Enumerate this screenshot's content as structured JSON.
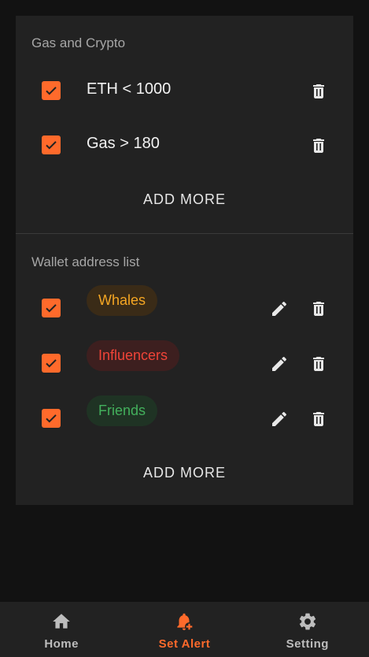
{
  "colors": {
    "accent": "#ff6a2b",
    "background": "#121212",
    "card": "#222222",
    "whales": "#f5a623",
    "influencers": "#f04438",
    "friends": "#43b05c"
  },
  "gas_section": {
    "title": "Gas and Crypto",
    "items": [
      {
        "label": "ETH < 1000",
        "checked": true
      },
      {
        "label": "Gas > 180",
        "checked": true
      }
    ],
    "add_more": "ADD MORE"
  },
  "wallet_section": {
    "title": "Wallet address list",
    "items": [
      {
        "label": "Whales",
        "checked": true
      },
      {
        "label": "Influencers",
        "checked": true
      },
      {
        "label": "Friends",
        "checked": true
      }
    ],
    "add_more": "ADD MORE"
  },
  "nav": {
    "items": [
      {
        "label": "Home",
        "icon": "home-icon"
      },
      {
        "label": "Set Alert",
        "icon": "bell-plus-icon",
        "active": true
      },
      {
        "label": "Setting",
        "icon": "gear-icon"
      }
    ]
  }
}
